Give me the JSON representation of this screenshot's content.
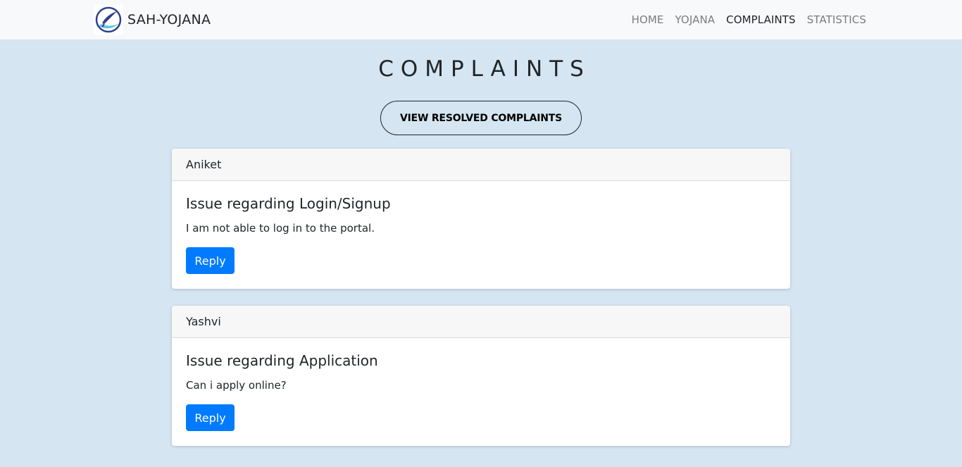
{
  "brand": {
    "name": "SAH-YOJANA"
  },
  "nav": {
    "home": "HOME",
    "yojana": "YOJANA",
    "complaints": "COMPLAINTS",
    "statistics": "STATISTICS"
  },
  "page": {
    "title": "COMPLAINTS",
    "resolved_button": "VIEW RESOLVED COMPLAINTS"
  },
  "complaints": [
    {
      "user": "Aniket",
      "title": "Issue regarding Login/Signup",
      "text": "I am not able to log in to the portal.",
      "reply_label": "Reply"
    },
    {
      "user": "Yashvi",
      "title": "Issue regarding Application",
      "text": "Can i apply online?",
      "reply_label": "Reply"
    }
  ],
  "colors": {
    "page_background": "#d5e5f1",
    "navbar_background": "#f8f9fa",
    "primary": "#007bff"
  }
}
